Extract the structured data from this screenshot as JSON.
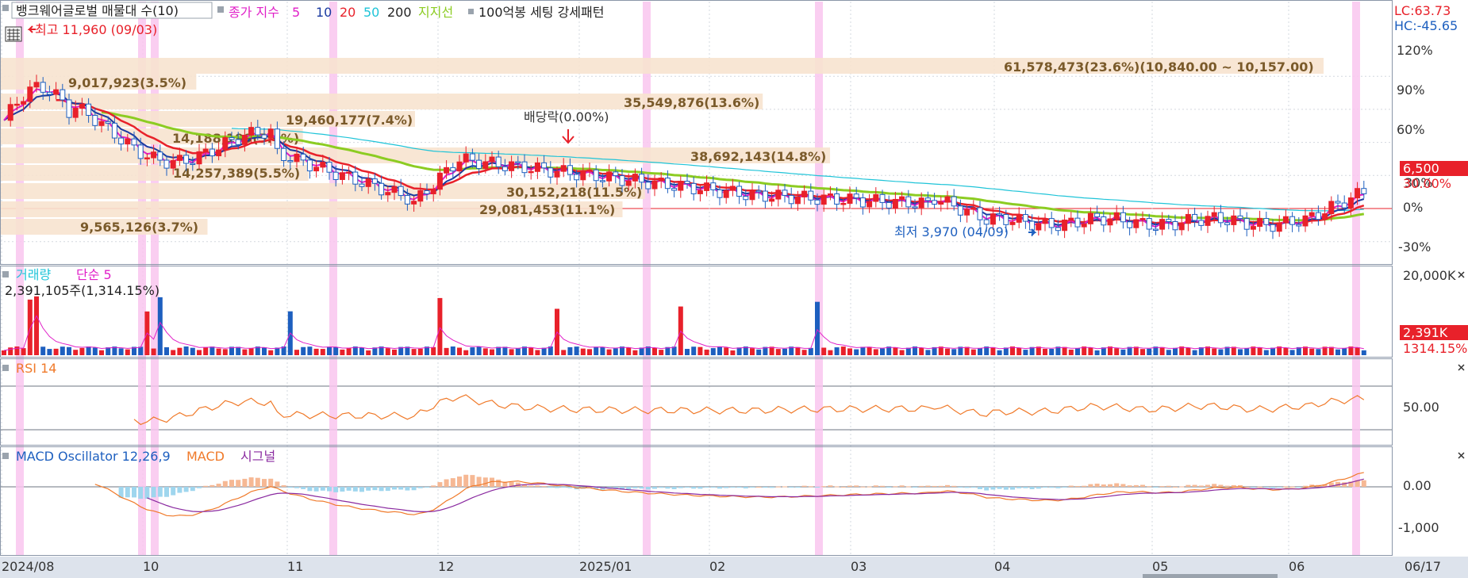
{
  "header": {
    "stock": "뱅크웨어글로벌 매물대 수(10)",
    "ma_prefix": "종가 지수",
    "ma_periods": [
      "5",
      "10",
      "20",
      "50",
      "200"
    ],
    "support": "지지선",
    "pattern": "100억봉 세팅 강세패턴",
    "lc": "LC:63.73",
    "hc": "HC:-45.65"
  },
  "price_panel": {
    "high_label": "최고 11,960 (09/03)",
    "low_label": "최저 3,970 (04/09)",
    "dividend_label": "배당락(0.00%)",
    "last_price": "6,500",
    "last_pct": "30.00%",
    "y_ticks": [
      "120%",
      "90%",
      "60%",
      "30%",
      "0%",
      "-30%"
    ],
    "volume_profile": [
      {
        "label": "61,578,473(23.6%)(10,840.00 ~ 10,157.00)",
        "pct": 23.6
      },
      {
        "label": "35,549,876(13.6%)",
        "pct": 13.6
      },
      {
        "label": "9,017,923(3.5%)",
        "pct": 3.5
      },
      {
        "label": "19,460,177(7.4%)",
        "pct": 7.4
      },
      {
        "label": "14,188,199(5.4%)",
        "pct": 5.4
      },
      {
        "label": "38,692,143(14.8%)",
        "pct": 14.8
      },
      {
        "label": "14,257,389(5.5%)",
        "pct": 5.5
      },
      {
        "label": "30,152,218(11.5%)",
        "pct": 11.5
      },
      {
        "label": "29,081,453(11.1%)",
        "pct": 11.1
      },
      {
        "label": "9,565,126(3.7%)",
        "pct": 3.7
      }
    ]
  },
  "volume_panel": {
    "title": "거래량",
    "ma": "단순 5",
    "info": "2,391,105주(1,314.15%)",
    "y_tick": "20,000K",
    "last": "2,391K",
    "last_pct": "1314.15%"
  },
  "rsi_panel": {
    "title": "RSI 14",
    "y_tick": "50.00"
  },
  "macd_panel": {
    "title": "MACD Oscillator 12,26,9",
    "macd": "MACD",
    "signal": "시그널",
    "y_ticks": [
      "0.00",
      "-1,000"
    ]
  },
  "x_axis": {
    "labels": [
      "2024/08",
      "10",
      "11",
      "12",
      "2025/01",
      "02",
      "03",
      "04",
      "05",
      "06"
    ],
    "right_label": "06/17"
  },
  "colors": {
    "up": "#e8212a",
    "down": "#1d5fbf",
    "ma5": "#e020c8",
    "ma10": "#1a3aa0",
    "ma20": "#e8212a",
    "ma50": "#1fc4d8",
    "support": "#8ccc22",
    "profile": "#f7e3cf",
    "highlight": "#f9c6ee",
    "rsi": "#f07a2a",
    "macd": "#f07a2a",
    "signal": "#8a2aa0",
    "osc_pos": "#f6b894",
    "osc_neg": "#9fd6ee"
  },
  "chart_data": {
    "type": "candlestick",
    "x_start": "2024-08-01",
    "x_end": "2025-06-17",
    "price": {
      "ylim": [
        -45.65,
        63.73
      ],
      "high": 11960,
      "high_date": "09/03",
      "low": 3970,
      "low_date": "04/09",
      "last": 6500
    },
    "volume_profile": {
      "pct": [
        23.6,
        13.6,
        3.5,
        7.4,
        5.4,
        14.8,
        5.5,
        11.5,
        11.1,
        3.7
      ]
    },
    "volume": {
      "max": 20000,
      "last": 2391,
      "last_pct": 1314.15,
      "unit": "K"
    },
    "rsi": {
      "period": 14,
      "ref_level": 50
    },
    "macd": {
      "params": [
        12,
        26,
        9
      ],
      "ref_level": 0
    }
  }
}
